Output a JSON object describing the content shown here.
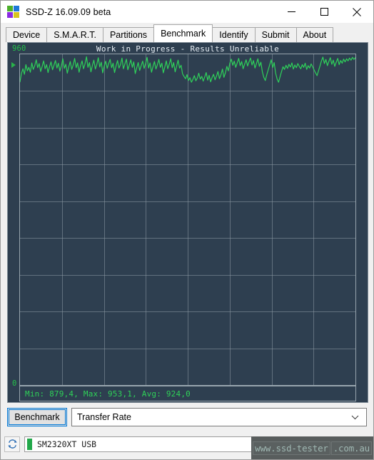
{
  "window": {
    "title": "SSD-Z 16.09.09 beta",
    "app_icon": "ssdz-squares-icon",
    "icon_colors": [
      "#4caf2a",
      "#1e78d7",
      "#8a2be2",
      "#d7c41e"
    ],
    "controls": {
      "minimize": "minimize-button",
      "maximize": "maximize-button",
      "close": "close-button"
    }
  },
  "tabs": [
    {
      "label": "Device",
      "selected": false
    },
    {
      "label": "S.M.A.R.T.",
      "selected": false
    },
    {
      "label": "Partitions",
      "selected": false
    },
    {
      "label": "Benchmark",
      "selected": true
    },
    {
      "label": "Identify",
      "selected": false
    },
    {
      "label": "Submit",
      "selected": false
    },
    {
      "label": "About",
      "selected": false
    }
  ],
  "chart_data": {
    "type": "line",
    "title": "Work in Progress - Results Unreliable",
    "xlabel": "",
    "ylabel": "",
    "ylim": [
      0,
      960
    ],
    "y_tick_labels": [
      "960",
      "0"
    ],
    "grid": true,
    "grid_columns": 8,
    "grid_rows": 9,
    "legend": "none",
    "series": [
      {
        "name": "Transfer Rate",
        "color": "#2fd15a",
        "values": [
          880,
          905,
          918,
          902,
          930,
          912,
          922,
          908,
          935,
          916,
          927,
          944,
          921,
          933,
          910,
          925,
          941,
          918,
          930,
          907,
          924,
          938,
          915,
          928,
          942,
          920,
          934,
          911,
          926,
          947,
          919,
          931,
          905,
          923,
          939,
          916,
          929,
          948,
          921,
          935,
          908,
          927,
          941,
          918,
          932,
          953,
          922,
          936,
          909,
          928,
          943,
          917,
          931,
          950,
          923,
          937,
          906,
          925,
          940,
          919,
          933,
          945,
          921,
          934,
          907,
          926,
          942,
          920,
          930,
          949,
          918,
          932,
          946,
          915,
          929,
          944,
          922,
          938,
          904,
          921,
          936,
          913,
          927,
          940,
          919,
          933,
          951,
          920,
          935,
          908,
          924,
          939,
          917,
          930,
          945,
          922,
          934,
          906,
          923,
          941,
          918,
          931,
          947,
          921,
          936,
          909,
          926,
          943,
          920,
          928,
          903,
          896,
          889,
          901,
          884,
          892,
          879,
          887,
          898,
          883,
          891,
          905,
          888,
          896,
          882,
          894,
          907,
          885,
          899,
          880,
          893,
          902,
          886,
          897,
          910,
          889,
          901,
          917,
          893,
          906,
          925,
          912,
          934,
          946,
          928,
          940,
          922,
          935,
          948,
          927,
          939,
          918,
          931,
          944,
          926,
          938,
          949,
          929,
          942,
          920,
          933,
          947,
          925,
          937,
          909,
          893,
          884,
          901,
          915,
          930,
          944,
          922,
          936,
          905,
          888,
          879,
          895,
          910,
          924,
          916,
          928,
          919,
          931,
          923,
          935,
          917,
          929,
          921,
          933,
          925,
          918,
          930,
          922,
          934,
          916,
          927,
          920,
          932,
          924,
          915,
          906,
          898,
          912,
          926,
          941,
          952,
          933,
          945,
          927,
          939,
          950,
          931,
          943,
          925,
          937,
          948,
          930,
          942,
          934,
          946,
          938,
          947,
          941,
          949,
          943,
          951,
          945,
          950
        ]
      }
    ],
    "stats": {
      "min_label": "Min:",
      "min": "879,4",
      "max_label": "Max:",
      "max": "953,1",
      "avg_label": "Avg:",
      "avg": "924,0",
      "text": "Min: 879,4, Max: 953,1, Avg: 924,0"
    }
  },
  "controls": {
    "benchmark_button": "Benchmark",
    "mode_select": {
      "value": "Transfer Rate",
      "options": [
        "Transfer Rate"
      ],
      "arrow_icon": "chevron-down-icon"
    }
  },
  "statusbar": {
    "refresh_icon": "refresh-icon",
    "device": "SM2320XT USB",
    "device_status_color": "#22a84a"
  },
  "watermark": {
    "part_a": "www.ssd-tester",
    "part_b": ".com.au",
    "full": "www.ssd-tester.com.au"
  }
}
